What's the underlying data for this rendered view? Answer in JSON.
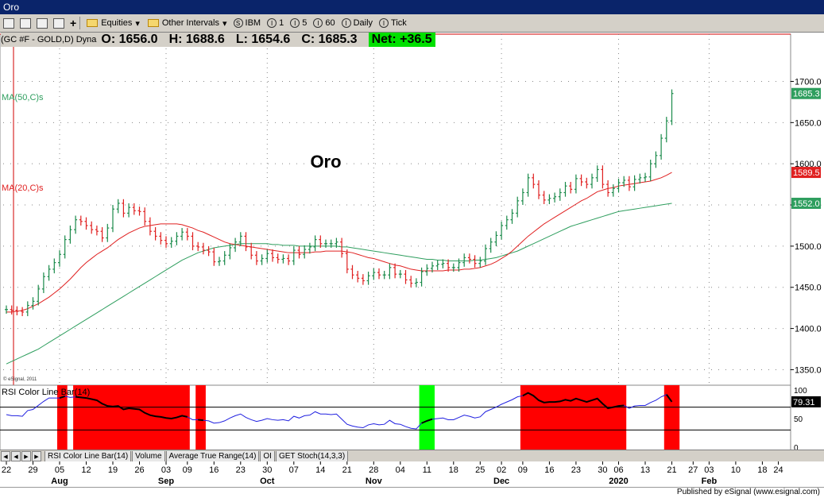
{
  "window": {
    "title": "Oro"
  },
  "toolbar": {
    "equities": "Equities",
    "other_intervals": "Other Intervals",
    "symbol": "IBM",
    "i1": "1",
    "i5": "5",
    "i60": "60",
    "daily": "Daily",
    "tick": "Tick",
    "dropdown_arrow": "▾"
  },
  "quote": {
    "symbol_line": "(GC #F - GOLD,D) Dyna",
    "open": "O: 1656.0",
    "high": "H: 1688.6",
    "low": "L: 1654.6",
    "close": "C: 1685.3",
    "net": "Net: +36.5"
  },
  "chart_data": {
    "type": "line",
    "title": "Oro",
    "price_ticks": [
      "1700.0",
      "1650.0",
      "1600.0",
      "1550.0",
      "1500.0",
      "1450.0",
      "1400.0",
      "1350.0"
    ],
    "price_values": [
      1700,
      1650,
      1600,
      1550,
      1500,
      1450,
      1400,
      1350
    ],
    "ylim": [
      1335,
      1740
    ],
    "last_price": "1685.3",
    "ma20_value": "1589.5",
    "ma50_value": "1552.0",
    "ma50_label": "MA(50,C)s",
    "ma20_label": "MA(20,C)s",
    "copyright": "© eSignal, 2011",
    "colors": {
      "bar": "#1a8a4a",
      "ma20": "#e02020",
      "ma50": "#2e9e5e",
      "rsi": "#2020e0",
      "rsi_hot": "#ff0000",
      "rsi_cold": "#00ff00"
    },
    "close": [
      1423,
      1422,
      1421,
      1420,
      1428,
      1433,
      1448,
      1463,
      1472,
      1480,
      1490,
      1508,
      1520,
      1532,
      1530,
      1525,
      1520,
      1518,
      1510,
      1522,
      1545,
      1552,
      1540,
      1547,
      1543,
      1542,
      1530,
      1518,
      1512,
      1507,
      1503,
      1506,
      1512,
      1517,
      1512,
      1500,
      1499,
      1495,
      1493,
      1481,
      1482,
      1489,
      1498,
      1505,
      1512,
      1499,
      1489,
      1482,
      1485,
      1491,
      1486,
      1484,
      1485,
      1482,
      1495,
      1490,
      1496,
      1499,
      1508,
      1503,
      1503,
      1503,
      1505,
      1491,
      1472,
      1465,
      1461,
      1458,
      1464,
      1468,
      1465,
      1465,
      1474,
      1466,
      1466,
      1459,
      1455,
      1456,
      1469,
      1473,
      1476,
      1478,
      1479,
      1474,
      1474,
      1480,
      1486,
      1484,
      1479,
      1482,
      1497,
      1505,
      1513,
      1525,
      1532,
      1540,
      1555,
      1565,
      1583,
      1575,
      1562,
      1556,
      1558,
      1560,
      1565,
      1573,
      1569,
      1582,
      1578,
      1575,
      1583,
      1593,
      1575,
      1565,
      1570,
      1577,
      1580,
      1572,
      1581,
      1583,
      1584,
      1600,
      1610,
      1631,
      1652,
      1685.3
    ],
    "ma20": [
      1420,
      1420,
      1421,
      1422,
      1424,
      1427,
      1430,
      1434,
      1438,
      1443,
      1448,
      1454,
      1460,
      1467,
      1474,
      1480,
      1485,
      1490,
      1494,
      1498,
      1503,
      1508,
      1512,
      1516,
      1519,
      1522,
      1524,
      1525,
      1526,
      1527,
      1527,
      1527,
      1527,
      1526,
      1524,
      1522,
      1519,
      1517,
      1514,
      1511,
      1508,
      1505,
      1503,
      1502,
      1501,
      1500,
      1499,
      1498,
      1497,
      1496,
      1495,
      1494,
      1493,
      1492,
      1492,
      1492,
      1492,
      1492,
      1493,
      1493,
      1494,
      1494,
      1494,
      1494,
      1493,
      1492,
      1490,
      1488,
      1486,
      1485,
      1483,
      1481,
      1479,
      1477,
      1476,
      1474,
      1472,
      1471,
      1470,
      1470,
      1470,
      1470,
      1470,
      1471,
      1471,
      1471,
      1472,
      1472,
      1473,
      1474,
      1476,
      1478,
      1481,
      1485,
      1489,
      1494,
      1500,
      1506,
      1512,
      1517,
      1522,
      1527,
      1531,
      1535,
      1539,
      1543,
      1547,
      1551,
      1555,
      1558,
      1562,
      1566,
      1568,
      1570,
      1571,
      1573,
      1574,
      1575,
      1576,
      1577,
      1578,
      1579,
      1581,
      1583,
      1586,
      1589.5
    ],
    "ma50": [
      1357,
      1360,
      1363,
      1366,
      1369,
      1372,
      1375,
      1379,
      1383,
      1387,
      1391,
      1395,
      1399,
      1403,
      1407,
      1411,
      1415,
      1419,
      1423,
      1427,
      1431,
      1435,
      1439,
      1443,
      1447,
      1451,
      1455,
      1459,
      1463,
      1467,
      1471,
      1475,
      1479,
      1483,
      1486,
      1489,
      1492,
      1494,
      1496,
      1498,
      1499,
      1500,
      1501,
      1502,
      1503,
      1503,
      1503,
      1503,
      1503,
      1503,
      1502,
      1502,
      1501,
      1501,
      1501,
      1500,
      1500,
      1500,
      1500,
      1500,
      1500,
      1500,
      1500,
      1499,
      1499,
      1498,
      1497,
      1496,
      1495,
      1494,
      1493,
      1492,
      1491,
      1490,
      1489,
      1488,
      1487,
      1486,
      1485,
      1484,
      1484,
      1483,
      1483,
      1482,
      1482,
      1482,
      1482,
      1482,
      1483,
      1483,
      1484,
      1485,
      1486,
      1488,
      1490,
      1492,
      1494,
      1497,
      1500,
      1503,
      1506,
      1509,
      1512,
      1515,
      1518,
      1521,
      1524,
      1526,
      1528,
      1530,
      1532,
      1534,
      1536,
      1538,
      1540,
      1542,
      1543,
      1544,
      1545,
      1546,
      1547,
      1548,
      1549,
      1550,
      1551,
      1552.0
    ],
    "rsi_label": "RSI Color Line Bar(14)",
    "rsi_value": "79.31",
    "rsi_ticks": [
      "100",
      "50",
      "0"
    ],
    "rsi": [
      57,
      55,
      55,
      54,
      64,
      66,
      73,
      80,
      86,
      86,
      86,
      89,
      87,
      88,
      87,
      86,
      84,
      82,
      76,
      72,
      71,
      72,
      66,
      68,
      67,
      66,
      60,
      56,
      54,
      53,
      51,
      50,
      52,
      55,
      53,
      48,
      48,
      47,
      46,
      42,
      43,
      46,
      51,
      55,
      58,
      52,
      48,
      45,
      47,
      50,
      48,
      47,
      48,
      46,
      54,
      51,
      55,
      56,
      62,
      58,
      58,
      57,
      58,
      49,
      40,
      37,
      35,
      34,
      39,
      41,
      39,
      40,
      47,
      41,
      40,
      36,
      33,
      32,
      42,
      46,
      49,
      50,
      51,
      48,
      48,
      52,
      56,
      54,
      51,
      53,
      62,
      66,
      70,
      75,
      79,
      83,
      88,
      90,
      95,
      90,
      82,
      78,
      79,
      79,
      80,
      83,
      81,
      85,
      82,
      79,
      82,
      85,
      76,
      68,
      70,
      72,
      73,
      68,
      72,
      73,
      73,
      78,
      82,
      88,
      92,
      79.31
    ],
    "rsi_hot_spans": [
      [
        10,
        11
      ],
      [
        13,
        34
      ],
      [
        36,
        37
      ],
      [
        97,
        116
      ],
      [
        124,
        126
      ]
    ],
    "rsi_cold_spans": [
      [
        78,
        80
      ]
    ],
    "day_labels": [
      "22",
      "29",
      "05",
      "12",
      "19",
      "26",
      "03",
      "09",
      "16",
      "23",
      "30",
      "07",
      "14",
      "21",
      "28",
      "04",
      "11",
      "18",
      "25",
      "02",
      "09",
      "16",
      "23",
      "30",
      "06",
      "13",
      "21",
      "27",
      "03",
      "10",
      "18",
      "24"
    ],
    "day_index": [
      0,
      5,
      10,
      15,
      20,
      25,
      30,
      34,
      39,
      44,
      49,
      54,
      59,
      64,
      69,
      74,
      79,
      84,
      89,
      93,
      97,
      102,
      107,
      112,
      115,
      120,
      125,
      129,
      132,
      137,
      142,
      145
    ],
    "month_labels": [
      "Aug",
      "Sep",
      "Oct",
      "Nov",
      "Dec",
      "2020",
      "Feb"
    ],
    "month_index": [
      10,
      30,
      49,
      69,
      93,
      115,
      132
    ],
    "grid": true
  },
  "tabs": [
    "RSI Color Line Bar(14)",
    "Volume",
    "Average True Range(14)",
    "OI",
    "GET Stoch(14,3,3)"
  ],
  "footer": {
    "text": "Published by eSignal (www.esignal.com)"
  }
}
